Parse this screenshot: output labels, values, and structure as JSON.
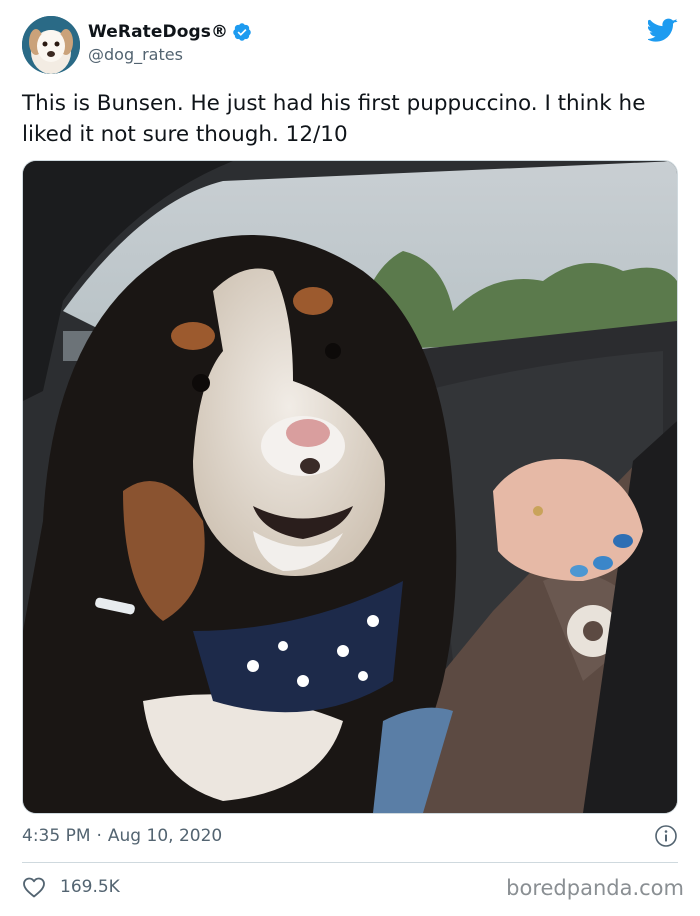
{
  "user": {
    "display_name": "WeRateDogs®",
    "handle": "@dog_rates",
    "verified": true,
    "avatar_icon": "dog-avatar"
  },
  "tweet": {
    "text": "This is Bunsen. He just had his first puppuccino. I think he liked it not sure though. 12/10",
    "photo_subject": "dog-photo",
    "time": "4:35 PM",
    "separator": "·",
    "date": "Aug 10, 2020",
    "likes": "169.5K"
  },
  "icons": {
    "brand": "twitter-bird-icon",
    "verified": "verified-badge-icon",
    "info": "info-icon",
    "like": "heart-icon"
  },
  "colors": {
    "twitter_blue": "#1d9bf0",
    "secondary_text": "#536471",
    "primary_text": "#0f1419"
  },
  "watermark": "boredpanda.com"
}
